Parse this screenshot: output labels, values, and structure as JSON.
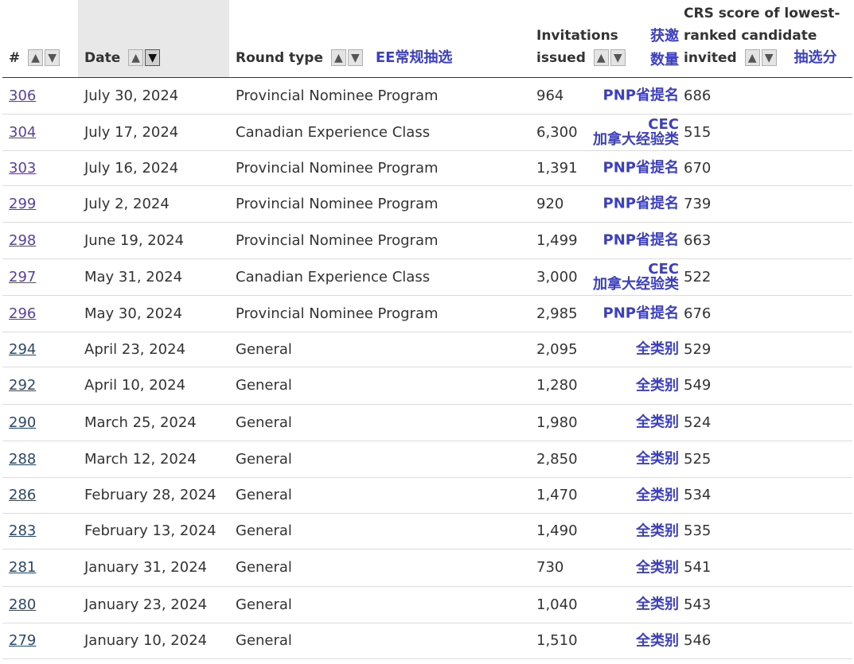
{
  "table": {
    "headers": {
      "num": "#",
      "date": "Date",
      "round_type": "Round type",
      "round_type_zh": "EE常规抽选",
      "invitations_line1": "Invitations",
      "invitations_line2": "issued",
      "invitations_zh_line1": "获邀",
      "invitations_zh_line2": "数量",
      "crs_line1": "CRS score of lowest-",
      "crs_line2": "ranked candidate",
      "crs_line3": "invited",
      "crs_zh": "抽选分"
    },
    "sort_up_icon": "▲",
    "sort_down_icon": "▼",
    "rows": [
      {
        "num": "306",
        "date": "July 30, 2024",
        "type": "Provincial Nominee Program",
        "invitations": "964",
        "cat_zh": "PNP省提名",
        "cat_zh2": "",
        "crs": "686"
      },
      {
        "num": "304",
        "date": "July 17, 2024",
        "type": "Canadian Experience Class",
        "invitations": "6,300",
        "cat_zh": "CEC",
        "cat_zh2": "加拿大经验类",
        "crs": "515"
      },
      {
        "num": "303",
        "date": "July 16, 2024",
        "type": "Provincial Nominee Program",
        "invitations": "1,391",
        "cat_zh": "PNP省提名",
        "cat_zh2": "",
        "crs": "670"
      },
      {
        "num": "299",
        "date": "July 2, 2024",
        "type": "Provincial Nominee Program",
        "invitations": "920",
        "cat_zh": "PNP省提名",
        "cat_zh2": "",
        "crs": "739"
      },
      {
        "num": "298",
        "date": "June 19, 2024",
        "type": "Provincial Nominee Program",
        "invitations": "1,499",
        "cat_zh": "PNP省提名",
        "cat_zh2": "",
        "crs": "663"
      },
      {
        "num": "297",
        "date": "May 31, 2024",
        "type": "Canadian Experience Class",
        "invitations": "3,000",
        "cat_zh": "CEC",
        "cat_zh2": "加拿大经验类",
        "crs": "522"
      },
      {
        "num": "296",
        "date": "May 30, 2024",
        "type": "Provincial Nominee Program",
        "invitations": "2,985",
        "cat_zh": "PNP省提名",
        "cat_zh2": "",
        "crs": "676"
      },
      {
        "num": "294",
        "date": "April 23, 2024",
        "type": "General",
        "invitations": "2,095",
        "cat_zh": "全类别",
        "cat_zh2": "",
        "crs": "529"
      },
      {
        "num": "292",
        "date": "April 10, 2024",
        "type": "General",
        "invitations": "1,280",
        "cat_zh": "全类别",
        "cat_zh2": "",
        "crs": "549"
      },
      {
        "num": "290",
        "date": "March 25, 2024",
        "type": "General",
        "invitations": "1,980",
        "cat_zh": "全类别",
        "cat_zh2": "",
        "crs": "524"
      },
      {
        "num": "288",
        "date": "March 12, 2024",
        "type": "General",
        "invitations": "2,850",
        "cat_zh": "全类别",
        "cat_zh2": "",
        "crs": "525"
      },
      {
        "num": "286",
        "date": "February 28, 2024",
        "type": "General",
        "invitations": "1,470",
        "cat_zh": "全类别",
        "cat_zh2": "",
        "crs": "534"
      },
      {
        "num": "283",
        "date": "February 13, 2024",
        "type": "General",
        "invitations": "1,490",
        "cat_zh": "全类别",
        "cat_zh2": "",
        "crs": "535"
      },
      {
        "num": "281",
        "date": "January 31, 2024",
        "type": "General",
        "invitations": "730",
        "cat_zh": "全类别",
        "cat_zh2": "",
        "crs": "541"
      },
      {
        "num": "280",
        "date": "January 23, 2024",
        "type": "General",
        "invitations": "1,040",
        "cat_zh": "全类别",
        "cat_zh2": "",
        "crs": "543"
      },
      {
        "num": "279",
        "date": "January 10, 2024",
        "type": "General",
        "invitations": "1,510",
        "cat_zh": "全类别",
        "cat_zh2": "",
        "crs": "546"
      }
    ]
  },
  "colors": {
    "annotation_zh": "#3a3ec8",
    "visited_link": "#5a3fa8",
    "link": "#2a4a6a",
    "sorted_header_bg": "#e8e8e8"
  }
}
